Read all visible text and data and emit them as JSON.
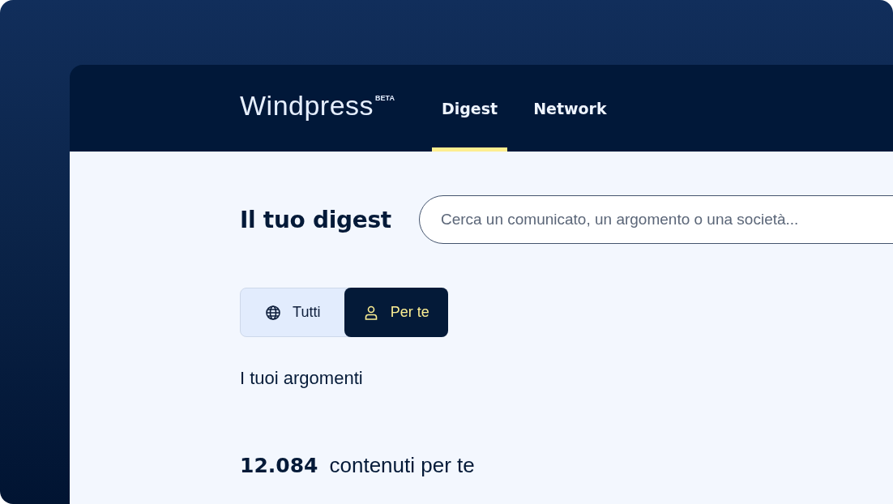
{
  "logo": {
    "name": "Windpress",
    "badge": "BETA"
  },
  "nav": [
    {
      "label": "Digest",
      "selected": true
    },
    {
      "label": "Network",
      "selected": false
    }
  ],
  "title": "Il tuo digest",
  "search": {
    "placeholder": "Cerca un comunicato, un argomento o una società..."
  },
  "filter": [
    {
      "label": "Tutti",
      "selected": false
    },
    {
      "label": "Per te",
      "selected": true
    }
  ],
  "topics_heading": "I tuoi argomenti",
  "count": {
    "value": "12.084",
    "label": "contenuti per te"
  }
}
